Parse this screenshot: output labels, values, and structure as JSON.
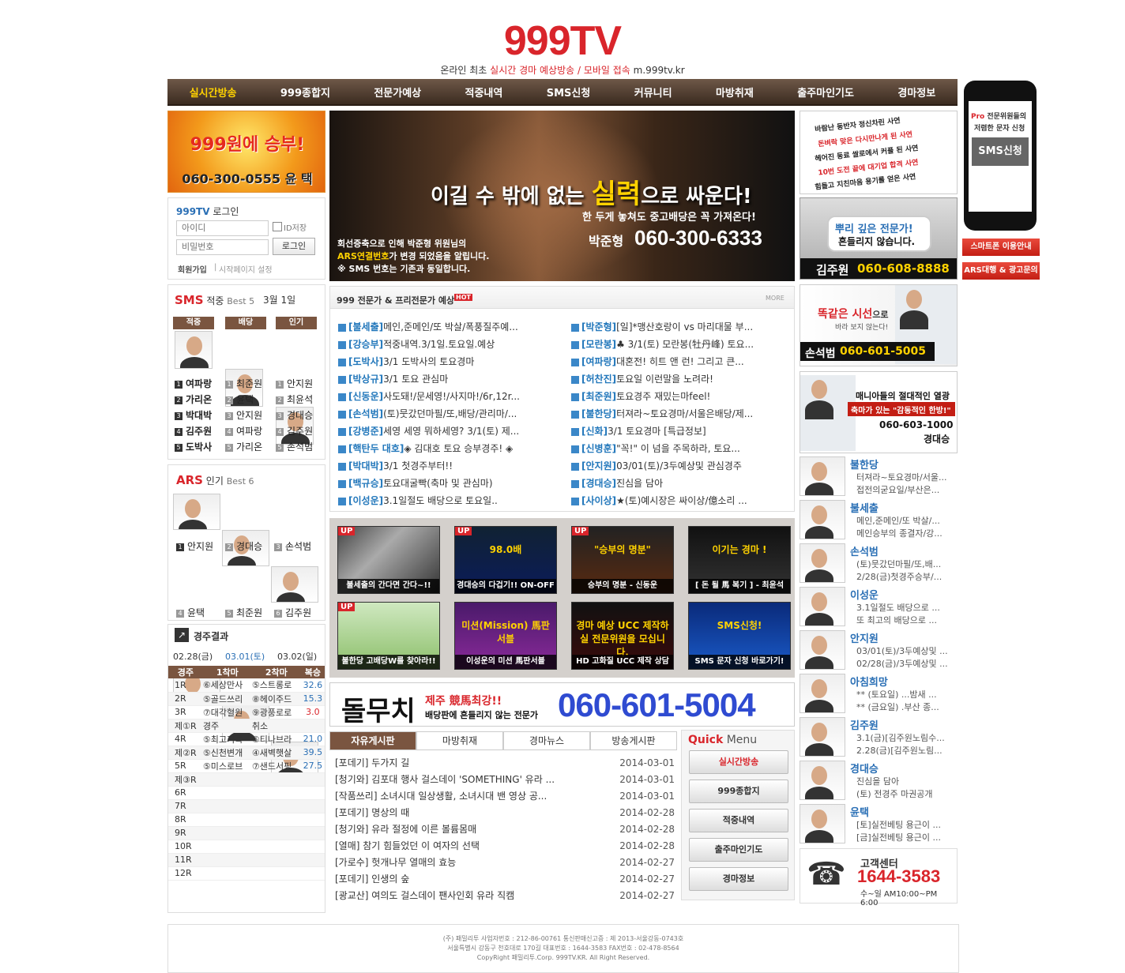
{
  "header": {
    "logo": "999TV",
    "tagline_a": "온라인 최초 ",
    "tagline_b": "실시간 경마 예상방송 / 모바일 접속",
    "tagline_c": " m.999tv.kr"
  },
  "nav": [
    "실시간방송",
    "999종합지",
    "전문가예상",
    "적중내역",
    "SMS신청",
    "커뮤니티",
    "마방취재",
    "출주마인기도",
    "경마정보"
  ],
  "banner_left": {
    "title": "999원에 승부!",
    "phone": "060-300-0555 윤 택"
  },
  "login": {
    "title_a": "999TV",
    "title_b": " 로그인",
    "id_placeholder": "아이디",
    "pw_placeholder": "비밀번호",
    "save_id": "ID저장",
    "login_btn": "로그인",
    "join": "회원가입",
    "home": "시작페이지 설정"
  },
  "hero": {
    "headline_a": "이길 수 밖에 없는 ",
    "headline_b": "실력",
    "headline_c": "으로 싸운다!",
    "sub": "한 두게 놓쳐도 중고배당은 꼭 가져온다!",
    "name": "박준형",
    "phone": "060-300-6333",
    "notice1": "회선증축으로 인해 박준형 위원님의",
    "notice2_a": "ARS연결번호",
    "notice2_b": "가 변경 되었음을 알립니다.",
    "notice3": "※ SMS 번호는 기존과 동일합니다."
  },
  "sms_best": {
    "title_a": "SMS",
    "title_b": " 적중 ",
    "title_c": "Best 5",
    "date": "3월 1일",
    "cats": [
      "적중",
      "배당",
      "인기"
    ],
    "rows": [
      [
        "여파랑",
        "최준원",
        "안지원"
      ],
      [
        "가리온",
        "윤택",
        "최윤석"
      ],
      [
        "박대박",
        "안지원",
        "경대승"
      ],
      [
        "김주원",
        "여파랑",
        "김주원"
      ],
      [
        "도박사",
        "가리온",
        "손석범"
      ]
    ]
  },
  "ars_best": {
    "title_a": "ARS",
    "title_b": " 인기 ",
    "title_c": "Best 6",
    "names": [
      "안지원",
      "경대승",
      "손석범",
      "윤택",
      "최준원",
      "김주원"
    ]
  },
  "results": {
    "title": "경주결과",
    "dates": [
      "02.28(금)",
      "03.01(토)",
      "03.02(일)"
    ],
    "headers": [
      "경주",
      "1착마",
      "2착마",
      "복승"
    ],
    "rows": [
      [
        "1R",
        "⑥세상만사",
        "⑤스트롱로",
        "32.6"
      ],
      [
        "2R",
        "⑤골드쓰리",
        "⑧헤이주드",
        "15.3"
      ],
      [
        "3R",
        "⑦대각혈원",
        "⑨광풍로로",
        "3.0"
      ],
      [
        "제①R",
        "경주",
        "취소",
        ""
      ],
      [
        "4R",
        "⑤최고기록",
        "⑥티나브라",
        "21.0"
      ],
      [
        "제②R",
        "⑤신천변개",
        "④새벽햇살",
        "39.5"
      ],
      [
        "5R",
        "⑤미스로브",
        "⑦샌드서핑",
        "27.5"
      ],
      [
        "제③R",
        "",
        "",
        ""
      ],
      [
        "6R",
        "",
        "",
        ""
      ],
      [
        "7R",
        "",
        "",
        ""
      ],
      [
        "8R",
        "",
        "",
        ""
      ],
      [
        "9R",
        "",
        "",
        ""
      ],
      [
        "10R",
        "",
        "",
        ""
      ],
      [
        "11R",
        "",
        "",
        ""
      ],
      [
        "12R",
        "",
        "",
        ""
      ]
    ]
  },
  "predictions": {
    "title": "999 전문가 & 프리전문가 예상",
    "hot": "HOT",
    "more": "MORE",
    "left": [
      [
        "[불세출]",
        "메인,준메인/또 박살/폭풍질주예..."
      ],
      [
        "[강승부]",
        "적중내역.3/1일.토요일.예상"
      ],
      [
        "[도박사]",
        "3/1 도박사의 토요경마"
      ],
      [
        "[박상규]",
        "3/1 토요 관심마"
      ],
      [
        "[신동운]",
        "사도돼!/문세영!/사지마!/6r,12r..."
      ],
      [
        "[손석범]",
        "(토)뭇갔던마필/또,배당/관리마/..."
      ],
      [
        "[강병준]",
        "세영 세영 뭐하세영? 3/1(토) 제..."
      ],
      [
        "[핵탄두 대호]",
        "◈ 김대호 토요 승부경주! ◈"
      ],
      [
        "[박대박]",
        "3/1 첫경주부터!!"
      ],
      [
        "[백규승]",
        "토요대굴빡(축마 및 관심마)"
      ],
      [
        "[이성운]",
        "3.1일절도 배당으로 토요일.."
      ]
    ],
    "right": [
      [
        "[박준형]",
        "[일]*맹산호랑이 vs 마리대물 부..."
      ],
      [
        "[모란봉]",
        "♣ 3/1(토) 모란봉(牡丹峰) 토요..."
      ],
      [
        "[여파랑]",
        "대혼전! 히트 앤 런! 그리고 큰..."
      ],
      [
        "[허찬진]",
        "토요일 이런말을 노려라!"
      ],
      [
        "[최준원]",
        "토요경주 재밌는마feel!"
      ],
      [
        "[불한당]",
        "터져라~토요경마/서울은배당/제..."
      ],
      [
        "[신화]",
        "3/1 토요경마 [특급정보]"
      ],
      [
        "[신병훈]",
        "\"꼭!\" 이 넘을 주목하라, 토요..."
      ],
      [
        "[안지원]",
        "03/01(토)/3두예상및 관심경주"
      ],
      [
        "[경대승]",
        "진심을 담아"
      ],
      [
        "[사이상]",
        "★(토)예시장은 싸이상/億소리 ..."
      ]
    ]
  },
  "videos": [
    {
      "cap": "불세출의 간다면 간다~!!",
      "up": "UP",
      "inner": ""
    },
    {
      "cap": "경대승의 다겁기!! ON-OFF의 한방",
      "up": "UP",
      "inner": "98.0배"
    },
    {
      "cap": "승부의 명분 - 신동운",
      "up": "UP",
      "inner": "\"승부의 명분\""
    },
    {
      "cap": "[ 돈 될 馬 복기 ] - 최윤석",
      "up": "",
      "inner": "이기는 경마 !"
    },
    {
      "cap": "불한당 고배당W를 찾아라!!",
      "up": "UP",
      "inner": ""
    },
    {
      "cap": "이성운의 미션 馬판서블",
      "up": "",
      "inner": "미션(Mission) 馬판 서블"
    },
    {
      "cap": "HD 고화질 UCC 제작 상담",
      "up": "",
      "inner": "경마 예상 UCC 제작하실 전문위원을 모십니다."
    },
    {
      "cap": "SMS 문자 신청 바로가기!",
      "up": "",
      "inner": "SMS신청!"
    }
  ],
  "ad_wide": {
    "name": "돌무치",
    "sub1": "제주 競馬최강!!",
    "sub2": "배당판에 흔들리지 않는 전문가",
    "phone": "060-601-5004"
  },
  "board": {
    "tabs": [
      "자유게시판",
      "마방취재",
      "경마뉴스",
      "방송게시판"
    ],
    "rows": [
      [
        "[포데기] 두가지 길",
        "2014-03-01"
      ],
      [
        "[청기와] 김포대 행사 걸스데이 'SOMETHING' 유라 ...",
        "2014-03-01"
      ],
      [
        "[작품쓰리] 소녀시대 일상생활, 소녀시대 밴 영상 공...",
        "2014-03-01"
      ],
      [
        "[포데기] 명상의 때",
        "2014-02-28"
      ],
      [
        "[청기와] 유라 절정에 이른 볼륨몸매",
        "2014-02-28"
      ],
      [
        "[열매] 참기 힘들었던 이 여자의 선택",
        "2014-02-28"
      ],
      [
        "[가로수] 헛개나무 열매의 효능",
        "2014-02-27"
      ],
      [
        "[포데기] 인생의 숲",
        "2014-02-27"
      ],
      [
        "[광교산] 여의도 걸스데이 팬사인회 유라 직캠",
        "2014-02-27"
      ]
    ]
  },
  "quick": {
    "title_a": "Quick",
    "title_b": " Menu",
    "items": [
      "실시간방송",
      "999종합지",
      "적중내역",
      "출주마인기도",
      "경마정보"
    ]
  },
  "right_ads": {
    "a1": [
      "바람난 동반자 정신차린 사연",
      "돈벼락 맞은 다시만나게 된 사연",
      "헤어진 동료 쌀로에서 커플 된 사연",
      "10번 도전 끝에 대기업 합격 사연",
      "힘들고 지친마음 용기를 얻은 사연"
    ],
    "a2_a": "뿌리 깊은 전문가!",
    "a2_b": "흔들리지 않습니다.",
    "a2_name": "김주원",
    "a2_phone": "060-608-8888",
    "a3_a": "똑같은 시선",
    "a3_b": "으로",
    "a3_c": "바라 보지 않는다!",
    "a3_name": "손석범",
    "a3_phone": "060-601-5005",
    "a4_a": "매니아들의 절대적인 열광",
    "a4_b": "축마가 있는 \"감동적인 한방!\"",
    "a4_phone": "060-603-1000",
    "a4_name": "경대승"
  },
  "experts": [
    {
      "name": "불한당",
      "l1": "터져라~토요경마/서울...",
      "l2": "접전의굳요일/부산은..."
    },
    {
      "name": "불세출",
      "l1": "메인,준메인/또 박살/...",
      "l2": "메인승부의 종결자/강..."
    },
    {
      "name": "손석범",
      "l1": "(토)뭇갔던마필/또,배...",
      "l2": "2/28(금)첫경주승부/..."
    },
    {
      "name": "이성운",
      "l1": "3.1일절도 배당으로 ...",
      "l2": "또 최고의 배당으로 ..."
    },
    {
      "name": "안지원",
      "l1": "03/01(토)/3두예상및 ...",
      "l2": "02/28(금)/3두예상및 ..."
    },
    {
      "name": "아침희망",
      "l1": "** (토요일) ...밤새 ...",
      "l2": "** (금요일) .부산 종..."
    },
    {
      "name": "김주원",
      "l1": "3.1(금)[김주원노림수...",
      "l2": "2.28(금)[김주원노림..."
    },
    {
      "name": "경대승",
      "l1": "진심을 담아",
      "l2": "(토) 전경주 마권공개"
    },
    {
      "name": "윤택",
      "l1": "[토]실전베팅 용근이 ...",
      "l2": "[금]실전베팅 용근이 ..."
    }
  ],
  "cs": {
    "title": "고객센터",
    "phone": "1644-3583",
    "hours": "수~일 AM10:00~PM 6:00"
  },
  "phone_ad": {
    "line1_a": "Pro",
    "line1_b": " 전문위원들의",
    "line2": "저렴한 문자 신청",
    "btn": "SMS신청",
    "s1": "스마트폰 이용안내",
    "s2": "ARS대행 & 광고문의"
  },
  "footer": {
    "l1": "(주) 패밀리투 사업자번호 : 212-86-00761 통신판매신고증 : 제 2013-서울강동-0743호",
    "l2": "서울특별시 강동구 천호대로 170길 대표번호 : 1644-3583 FAX번호 : 02-478-8564",
    "l3": "CopyRight 패밀리투.Corp. 999TV.KR. All Right Reserved."
  }
}
